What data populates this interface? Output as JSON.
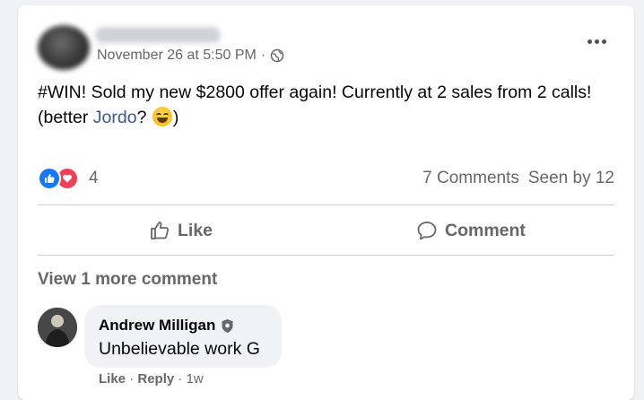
{
  "post": {
    "timestamp": "November 26 at 5:50 PM",
    "separator": "·",
    "audience_icon": "globe-icon",
    "text_hashtag": "#WIN",
    "text_main": "! Sold my new $2800 offer again! Currently at 2 sales from 2 calls! (better ",
    "text_mention": "Jordo",
    "text_after_mention": "? ",
    "text_emoji": "grinning-face-emoji",
    "text_end": ")"
  },
  "reactions": {
    "types": [
      "like",
      "love"
    ],
    "count": "4"
  },
  "stats": {
    "comments": "7 Comments",
    "seen_by": "Seen by 12"
  },
  "actions": {
    "like_label": "Like",
    "comment_label": "Comment"
  },
  "comments": {
    "view_more": "View 1 more comment",
    "items": [
      {
        "author": "Andrew Milligan",
        "text": "Unbelievable work G",
        "like_label": "Like",
        "reply_label": "Reply",
        "age": "1w"
      }
    ]
  },
  "colors": {
    "brand_blue": "#1877f2",
    "love_red": "#f33e58",
    "mention_blue": "#385898",
    "muted_text": "#65676b"
  }
}
